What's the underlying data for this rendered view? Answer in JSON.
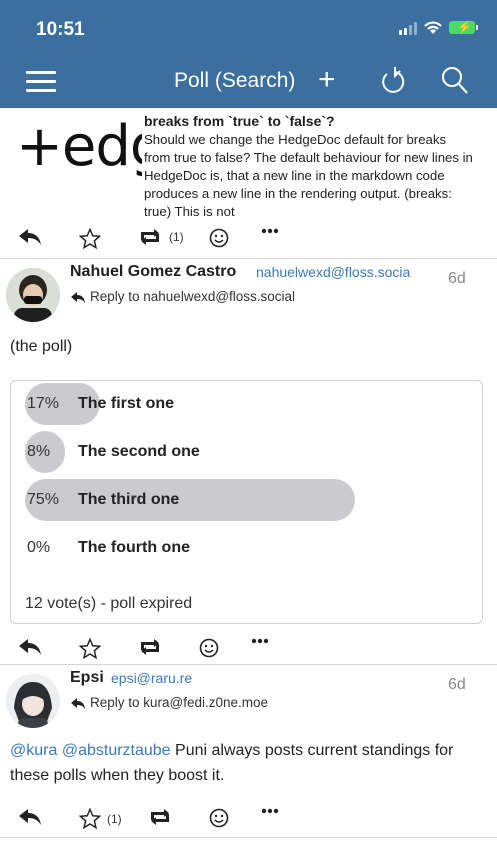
{
  "status_bar": {
    "time": "10:51"
  },
  "nav": {
    "title": "Poll (Search)",
    "add_label": "+"
  },
  "post1": {
    "logo_text": "Hedgedoc",
    "title": "breaks from `true` to `false`?",
    "body": "Should we change the HedgeDoc default for breaks from true to false? The default behaviour for new lines in HedgeDoc is, that a new line in the markdown code produces a new line in the rendering output. (breaks: true)  This is not",
    "boost_count": "(1)"
  },
  "post2": {
    "author": "Nahuel Gomez Castro",
    "handle": "nahuelwexd@floss.socia",
    "age": "6d",
    "reply_to": "Reply to nahuelwexd@floss.social",
    "text": "(the poll)",
    "poll": {
      "options": [
        {
          "pct_label": "17%",
          "label": "The first one",
          "fraction": 0.17
        },
        {
          "pct_label": "8%",
          "label": "The second one",
          "fraction": 0.08
        },
        {
          "pct_label": "75%",
          "label": "The third one",
          "fraction": 0.75
        },
        {
          "pct_label": "0%",
          "label": "The fourth one",
          "fraction": 0.0
        }
      ],
      "summary": "12 vote(s) - poll expired"
    }
  },
  "post3": {
    "author": "Epsi",
    "handle": "epsi@raru.re",
    "age": "6d",
    "reply_to": "Reply to kura@fedi.z0ne.moe",
    "mention1": "@kura",
    "mention2": "@absturztaube",
    "text_rest": " Puni always posts current standings for these polls when they boost it.",
    "favourite_count": "(1)"
  },
  "colors": {
    "header": "#3b6f9f",
    "link": "#3a7ab8",
    "poll_bar": "#cbcbcf"
  },
  "icons": [
    "menu-icon",
    "plus-icon",
    "refresh-icon",
    "search-icon",
    "reply-icon",
    "star-icon",
    "boost-icon",
    "emoji-icon",
    "more-icon"
  ]
}
